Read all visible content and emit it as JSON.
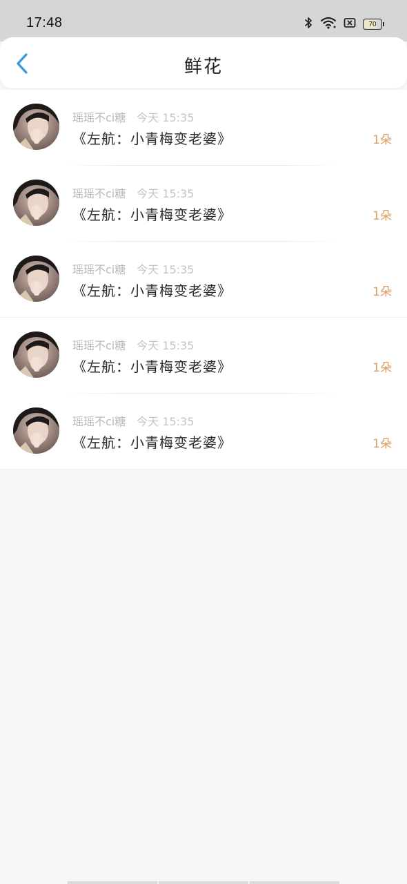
{
  "status_bar": {
    "time": "17:48",
    "battery": "70",
    "icons": [
      "bluetooth-icon",
      "wifi-icon",
      "sim-icon",
      "battery-icon"
    ]
  },
  "header": {
    "title": "鲜花",
    "back_icon": "chevron-left-icon"
  },
  "colors": {
    "accent_blue": "#2f9be6",
    "count_orange": "#e79a5b",
    "meta_gray": "#b9b9b9"
  },
  "rows": [
    {
      "user": "瑶瑶不ci糖",
      "time": "今天 15:35",
      "title": "《左航：小青梅变老婆》",
      "count": "1朵"
    },
    {
      "user": "瑶瑶不ci糖",
      "time": "今天 15:35",
      "title": "《左航：小青梅变老婆》",
      "count": "1朵"
    },
    {
      "user": "瑶瑶不ci糖",
      "time": "今天 15:35",
      "title": "《左航：小青梅变老婆》",
      "count": "1朵"
    },
    {
      "user": "瑶瑶不ci糖",
      "time": "今天 15:35",
      "title": "《左航：小青梅变老婆》",
      "count": "1朵"
    },
    {
      "user": "瑶瑶不ci糖",
      "time": "今天 15:35",
      "title": "《左航：小青梅变老婆》",
      "count": "1朵"
    }
  ]
}
